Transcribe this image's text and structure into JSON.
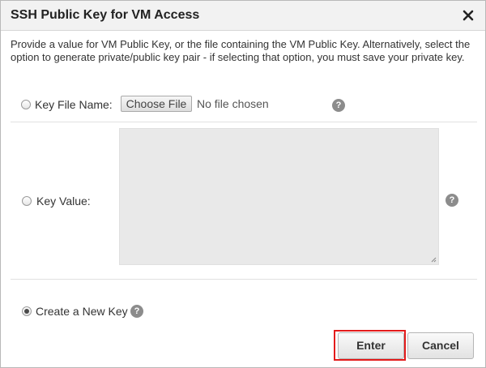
{
  "dialog": {
    "title": "SSH Public Key for VM Access",
    "close_icon": "close-icon",
    "instructions": "Provide a value for VM Public Key, or the file containing the VM Public Key. Alternatively, select the option to generate private/public key pair - if selecting that option, you must save your private key."
  },
  "options": {
    "key_file": {
      "label": "Key File Name:",
      "selected": false,
      "choose_button": "Choose File",
      "status": "No file chosen",
      "help_icon": "help-icon"
    },
    "key_value": {
      "label": "Key Value:",
      "selected": false,
      "value": "",
      "help_icon": "help-icon"
    },
    "create_new": {
      "label": "Create a New Key",
      "selected": true,
      "help_icon": "help-icon"
    }
  },
  "actions": {
    "enter_label": "Enter",
    "cancel_label": "Cancel",
    "highlighted": "Enter"
  },
  "colors": {
    "header_bg": "#f2f2f2",
    "textarea_bg": "#e9e9e9",
    "highlight": "#e31b1b",
    "help_icon": "#8c8c8c"
  }
}
